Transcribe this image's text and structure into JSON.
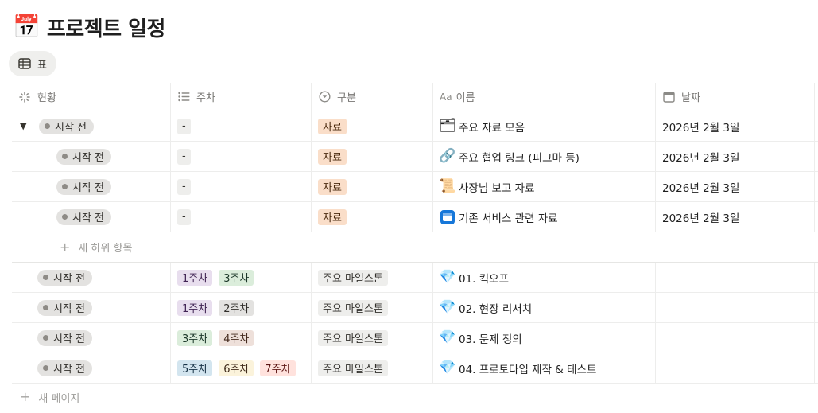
{
  "page": {
    "emoji": "📅",
    "title": "프로젝트 일정"
  },
  "view_tab": {
    "label": "표"
  },
  "columns": [
    {
      "label": "현황",
      "icon": "status-icon"
    },
    {
      "label": "주차",
      "icon": "list-icon"
    },
    {
      "label": "구분",
      "icon": "select-icon"
    },
    {
      "label": "이름",
      "icon": "text-icon",
      "icon_text": "Aa"
    },
    {
      "label": "날짜",
      "icon": "calendar-icon"
    }
  ],
  "rows": [
    {
      "status": "시작 전",
      "week": [
        "-"
      ],
      "category": "자료",
      "icon": "🗂",
      "name": "주요 자료 모음",
      "date": "2026년 2월 3일",
      "parent": true
    },
    {
      "status": "시작 전",
      "week": [
        "-"
      ],
      "category": "자료",
      "icon": "🔗",
      "name": "주요 협업 링크 (피그마 등)",
      "date": "2026년 2월 3일",
      "child": true
    },
    {
      "status": "시작 전",
      "week": [
        "-"
      ],
      "category": "자료",
      "icon": "📜",
      "name": "사장님 보고 자료",
      "date": "2026년 2월 3일",
      "child": true
    },
    {
      "status": "시작 전",
      "week": [
        "-"
      ],
      "category": "자료",
      "icon": "🪟",
      "name": "기존 서비스 관련 자료",
      "date": "2026년 2월 3일",
      "child": true
    },
    {
      "status": "시작 전",
      "week": [
        "1주차",
        "3주차"
      ],
      "category": "주요 마일스톤",
      "icon": "💎",
      "name": "01. 킥오프",
      "date": ""
    },
    {
      "status": "시작 전",
      "week": [
        "1주차",
        "2주차"
      ],
      "category": "주요 마일스톤",
      "icon": "💎",
      "name": "02. 현장 리서치",
      "date": ""
    },
    {
      "status": "시작 전",
      "week": [
        "3주차",
        "4주차"
      ],
      "category": "주요 마일스톤",
      "icon": "💎",
      "name": "03. 문제 정의",
      "date": ""
    },
    {
      "status": "시작 전",
      "week": [
        "5주차",
        "6주차",
        "7주차"
      ],
      "category": "주요 마일스톤",
      "icon": "💎",
      "name": "04. 프로토타입 제작 & 테스트",
      "date": ""
    }
  ],
  "add_subitem": {
    "label": "새 하위 항목"
  },
  "new_page": {
    "label": "새 페이지"
  },
  "colors": {
    "1주차": "#e8deee",
    "2주차": "#e3e2e0",
    "3주차": "#dbeddb",
    "4주차": "#eee0da",
    "5주차": "#d3e5ef",
    "6주차": "#fbf3db",
    "7주차": "#ffe2dd",
    "자료": "#fadec9"
  }
}
